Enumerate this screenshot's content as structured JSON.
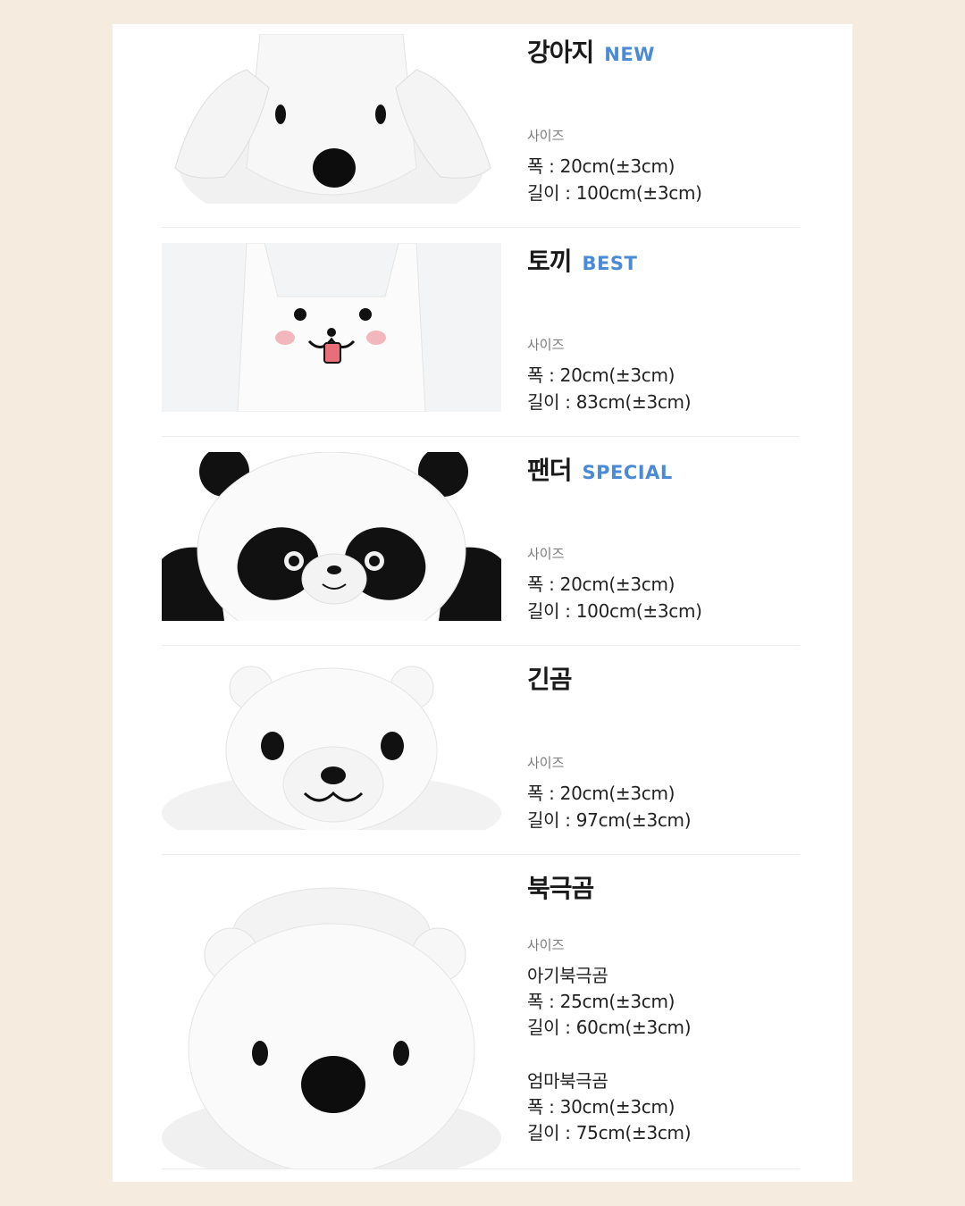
{
  "products": [
    {
      "name": "강아지",
      "badge": "NEW",
      "size_label": "사이즈",
      "width": "폭 : 20cm(±3cm)",
      "length": "길이 : 100cm(±3cm)"
    },
    {
      "name": "토끼",
      "badge": "BEST",
      "size_label": "사이즈",
      "width": "폭 : 20cm(±3cm)",
      "length": "길이 : 83cm(±3cm)"
    },
    {
      "name": "팬더",
      "badge": "SPECIAL",
      "size_label": "사이즈",
      "width": "폭 : 20cm(±3cm)",
      "length": "길이 : 100cm(±3cm)"
    },
    {
      "name": "긴곰",
      "badge": "",
      "size_label": "사이즈",
      "width": "폭 : 20cm(±3cm)",
      "length": "길이 : 97cm(±3cm)"
    },
    {
      "name": "북극곰",
      "badge": "",
      "size_label": "사이즈",
      "baby_label": "아기북극곰",
      "baby_width": "폭 : 25cm(±3cm)",
      "baby_length": "길이 : 60cm(±3cm)",
      "mom_label": "엄마북극곰",
      "mom_width": "폭 : 30cm(±3cm)",
      "mom_length": "길이 : 75cm(±3cm)"
    }
  ],
  "colors": {
    "background": "#f6ebdf",
    "card": "#ffffff",
    "badge": "#4a8ad6"
  }
}
